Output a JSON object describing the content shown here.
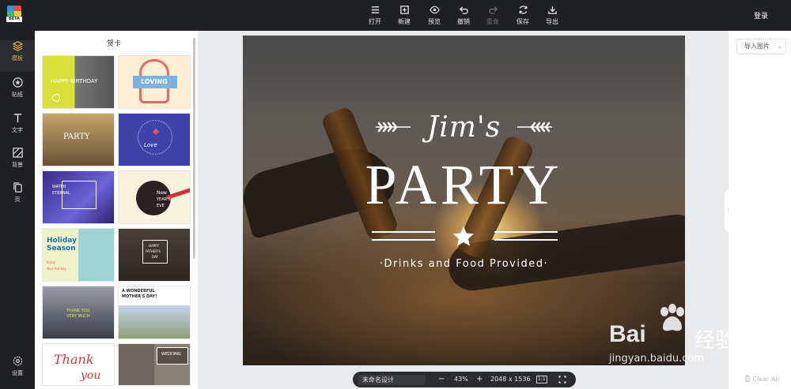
{
  "topbar": {
    "logo_badge": "BETA",
    "tools": [
      {
        "icon": "menu-icon",
        "label": "打开"
      },
      {
        "icon": "new-file-icon",
        "label": "新建"
      },
      {
        "icon": "eye-icon",
        "label": "预览"
      },
      {
        "icon": "undo-icon",
        "label": "撤销"
      },
      {
        "icon": "redo-icon",
        "label": "重做"
      },
      {
        "icon": "refresh-icon",
        "label": "保存"
      },
      {
        "icon": "export-icon",
        "label": "导出"
      }
    ],
    "login": "登录"
  },
  "sidenav": [
    {
      "icon": "layers-icon",
      "label": "模板"
    },
    {
      "icon": "sticker-icon",
      "label": "贴纸"
    },
    {
      "icon": "text-icon",
      "label": "文字"
    },
    {
      "icon": "background-icon",
      "label": "背景"
    },
    {
      "icon": "pages-icon",
      "label": "页"
    },
    {
      "icon": "settings-icon",
      "label": "设置"
    }
  ],
  "panel": {
    "title": "贺卡",
    "templates": [
      {
        "lines": [
          "HAPPY BIRTHDAY"
        ]
      },
      {
        "lines": [
          "LOVING"
        ]
      },
      {
        "lines": [
          "PARTY"
        ]
      },
      {
        "lines": [
          "Love"
        ]
      },
      {
        "lines": [
          "WATER",
          "ETERNAL"
        ]
      },
      {
        "lines": [
          "New",
          "YEAR'S",
          "EVE"
        ]
      },
      {
        "lines": [
          "Holiday",
          "Season",
          "Enjoy",
          "Your Holiday"
        ]
      },
      {
        "lines": [
          "HAPPY",
          "FATHER'S",
          "DAY"
        ]
      },
      {
        "lines": [
          "THANK YOU",
          "VERY MUCH"
        ]
      },
      {
        "lines": [
          "A WONDERFUL",
          "MOTHER'S DAY!"
        ]
      },
      {
        "lines": [
          "Thank",
          "you"
        ]
      },
      {
        "lines": [
          "WEDDING"
        ]
      }
    ]
  },
  "design": {
    "script_title": "Jim's",
    "main_title": "PARTY",
    "subtitle": "·Drinks and Food Provided·"
  },
  "statusbar": {
    "doc_name": "未命名设计",
    "minus": "−",
    "zoom": "43%",
    "plus": "+",
    "dimensions": "2048 x 1536",
    "ratio_label": "1:1"
  },
  "rightpanel": {
    "import_label": "导入图片",
    "clear_all": "Clear All"
  },
  "watermark": {
    "text1": "Bai",
    "text2": "经验",
    "url": "jingyan.baidu.com"
  },
  "colors": {
    "accent": "#e7b34a",
    "topbar_bg": "#1f2023"
  }
}
